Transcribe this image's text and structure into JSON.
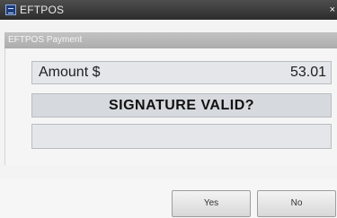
{
  "window": {
    "title": "EFTPOS",
    "close_glyph": "×"
  },
  "panel": {
    "header": "EFTPOS Payment",
    "amount_label": "Amount $",
    "amount_value": "53.01",
    "prompt": "SIGNATURE VALID?",
    "extra_value": ""
  },
  "buttons": {
    "yes": "Yes",
    "no": "No"
  }
}
